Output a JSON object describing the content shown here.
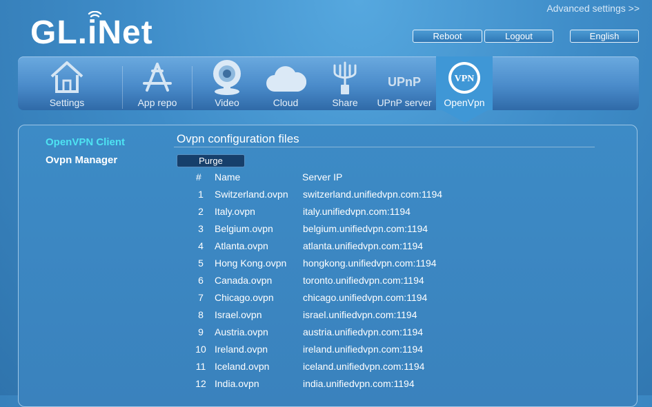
{
  "header": {
    "logo_text": "GL.iNet",
    "advanced_link": "Advanced settings >>",
    "reboot": "Reboot",
    "logout": "Logout",
    "language": "English"
  },
  "nav": [
    {
      "label": "Settings",
      "icon": "house-icon",
      "active": false
    },
    {
      "label": "App repo",
      "icon": "app-store-icon",
      "active": false
    },
    {
      "label": "Video",
      "icon": "webcam-icon",
      "active": false
    },
    {
      "label": "Cloud",
      "icon": "cloud-icon",
      "active": false
    },
    {
      "label": "Share",
      "icon": "usb-trident-icon",
      "active": false
    },
    {
      "label": "UPnP server",
      "icon": "upnp-icon",
      "active": false
    },
    {
      "label": "OpenVpn",
      "icon": "vpn-icon",
      "active": true
    }
  ],
  "nav_icon_text": {
    "upnp": "UPnP",
    "vpn": "VPN"
  },
  "sidebar": {
    "items": [
      {
        "label": "OpenVPN Client",
        "active": true
      },
      {
        "label": "Ovpn Manager",
        "active": false
      }
    ]
  },
  "main": {
    "title": "Ovpn configuration files",
    "purge_label": "Purge",
    "columns": [
      "#",
      "Name",
      "Server IP"
    ],
    "rows": [
      {
        "num": "1",
        "name": "Switzerland.ovpn",
        "ip": "switzerland.unifiedvpn.com:1194"
      },
      {
        "num": "2",
        "name": "Italy.ovpn",
        "ip": "italy.unifiedvpn.com:1194"
      },
      {
        "num": "3",
        "name": "Belgium.ovpn",
        "ip": "belgium.unifiedvpn.com:1194"
      },
      {
        "num": "4",
        "name": "Atlanta.ovpn",
        "ip": "atlanta.unifiedvpn.com:1194"
      },
      {
        "num": "5",
        "name": "Hong Kong.ovpn",
        "ip": "hongkong.unifiedvpn.com:1194"
      },
      {
        "num": "6",
        "name": "Canada.ovpn",
        "ip": "toronto.unifiedvpn.com:1194"
      },
      {
        "num": "7",
        "name": "Chicago.ovpn",
        "ip": "chicago.unifiedvpn.com:1194"
      },
      {
        "num": "8",
        "name": "Israel.ovpn",
        "ip": "israel.unifiedvpn.com:1194"
      },
      {
        "num": "9",
        "name": "Austria.ovpn",
        "ip": "austria.unifiedvpn.com:1194"
      },
      {
        "num": "10",
        "name": "Ireland.ovpn",
        "ip": "ireland.unifiedvpn.com:1194"
      },
      {
        "num": "11",
        "name": "Iceland.ovpn",
        "ip": "iceland.unifiedvpn.com:1194"
      },
      {
        "num": "12",
        "name": "India.ovpn",
        "ip": "india.unifiedvpn.com:1194"
      }
    ]
  },
  "colors": {
    "background": "#3e8cc8",
    "active_sidebar": "#4ee3f2",
    "purge_button": "#163f6b",
    "active_tab": "#3f97d6"
  }
}
